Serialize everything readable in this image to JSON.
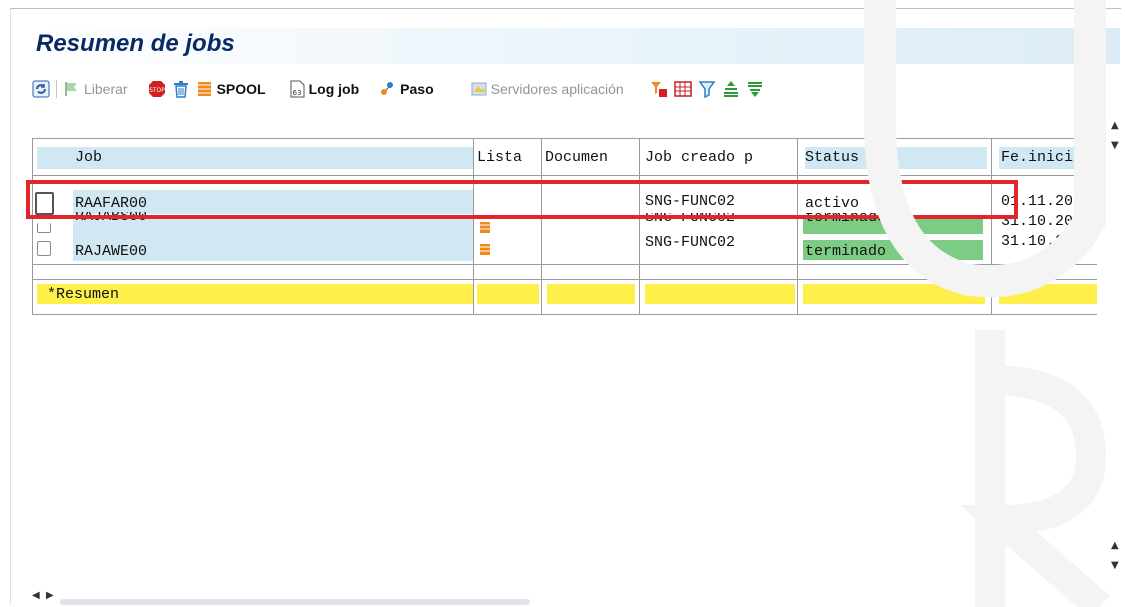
{
  "window": {
    "title": "Resumen de jobs"
  },
  "toolbar": {
    "refresh_icon": "refresh-icon",
    "release_label": "Liberar",
    "stop_icon": "stop-icon",
    "delete_icon": "trash-icon",
    "spool_label": "SPOOL",
    "joblog_label": "Log job",
    "step_label": "Paso",
    "app_servers_label": "Servidores aplicación",
    "extra_icons": [
      "filter-red-icon",
      "grid-icon",
      "funnel-icon",
      "sort-ascending-icon",
      "sort-descending-icon"
    ]
  },
  "table": {
    "columns": [
      "Job",
      "Lista",
      "Documen",
      "Job creado p",
      "Status",
      "Fe.inici"
    ],
    "rows": [
      {
        "job": "RAAFAR00",
        "lista": "",
        "documen": "",
        "creado": "SNG-FUNC02",
        "status": "activo",
        "fecha": "01.11.20",
        "status_color": ""
      },
      {
        "job": "RAJABS00",
        "lista": "spool",
        "documen": "",
        "creado": "SNG-FUNC02",
        "status": "terminado",
        "fecha": "31.10.20",
        "status_color": "#7ccc86"
      },
      {
        "job": "RAJAWE00",
        "lista": "spool",
        "documen": "",
        "creado": "SNG-FUNC02",
        "status": "terminado",
        "fecha": "31.10.20",
        "status_color": "#7ccc86"
      }
    ],
    "summary_label": "*Resumen"
  },
  "colors": {
    "header_bg": "#cfe8f4",
    "summary_bg": "#ffef4a",
    "status_done": "#7ccc86",
    "highlight": "#e0262b",
    "title": "#0a2a66"
  }
}
